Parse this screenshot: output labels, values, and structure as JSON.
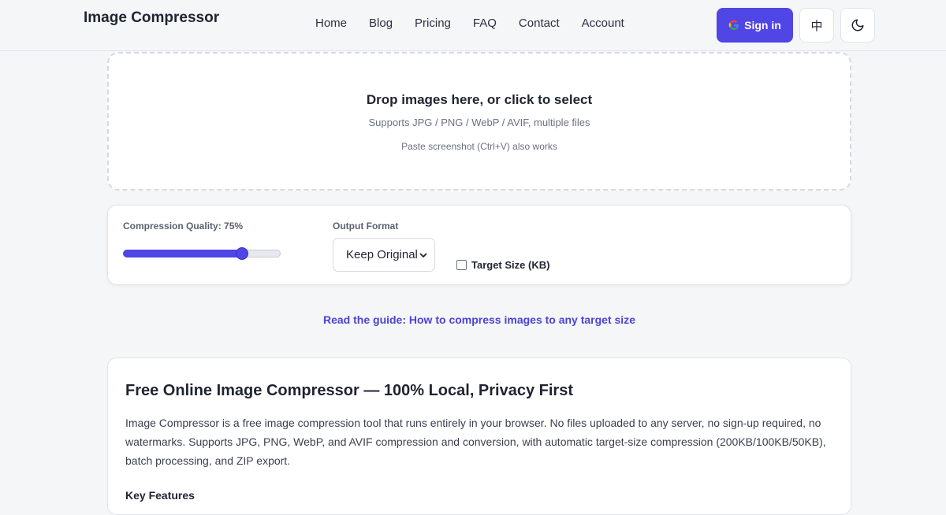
{
  "header": {
    "logo": "Image Compressor",
    "nav": [
      "Home",
      "Blog",
      "Pricing",
      "FAQ",
      "Contact",
      "Account"
    ],
    "signin_label": "Sign in",
    "lang_label": "中",
    "brand_color": "#5046e5"
  },
  "dropzone": {
    "title": "Drop images here, or click to select",
    "subtitle": "Supports JPG / PNG / WebP / AVIF, multiple files",
    "hint": "Paste screenshot (Ctrl+V) also works"
  },
  "settings": {
    "quality_label": "Compression Quality: 75%",
    "quality_value": 75,
    "format_label": "Output Format",
    "format_selected": "Keep Original",
    "target_label": "Target Size (KB)",
    "target_checked": false
  },
  "guide": {
    "link_text": "Read the guide: How to compress images to any target size"
  },
  "content": {
    "heading": "Free Online Image Compressor — 100% Local, Privacy First",
    "body": "Image Compressor is a free image compression tool that runs entirely in your browser. No files uploaded to any server, no sign-up required, no watermarks. Supports JPG, PNG, WebP, and AVIF compression and conversion, with automatic target-size compression (200KB/100KB/50KB), batch processing, and ZIP export.",
    "subheading": "Key Features"
  }
}
